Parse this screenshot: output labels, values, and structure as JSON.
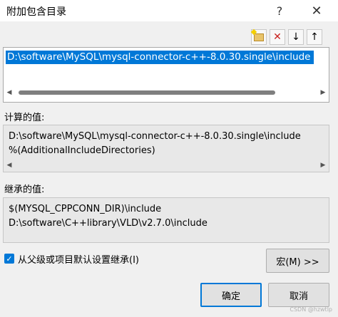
{
  "window": {
    "title": "附加包含目录",
    "help_label": "?",
    "close_label": "✕"
  },
  "toolbar": {
    "new_line_icon": "new-folder-icon",
    "delete_label": "✕",
    "move_down_label": "↓",
    "move_up_label": "↑"
  },
  "list": {
    "items": [
      "D:\\software\\MySQL\\mysql-connector-c++-8.0.30.single\\include"
    ]
  },
  "computed": {
    "label": "计算的值:",
    "lines": [
      "D:\\software\\MySQL\\mysql-connector-c++-8.0.30.single\\include",
      "%(AdditionalIncludeDirectories)"
    ]
  },
  "inherited": {
    "label": "继承的值:",
    "lines": [
      "$(MYSQL_CPPCONN_DIR)\\include",
      "D:\\software\\C++library\\VLD\\v2.7.0\\include"
    ]
  },
  "inherit_checkbox": {
    "label": "从父级或项目默认设置继承(I)",
    "checked": true
  },
  "buttons": {
    "macro": "宏(M) >>",
    "ok": "确定",
    "cancel": "取消"
  },
  "watermark": "CSDN @hzwtlp"
}
